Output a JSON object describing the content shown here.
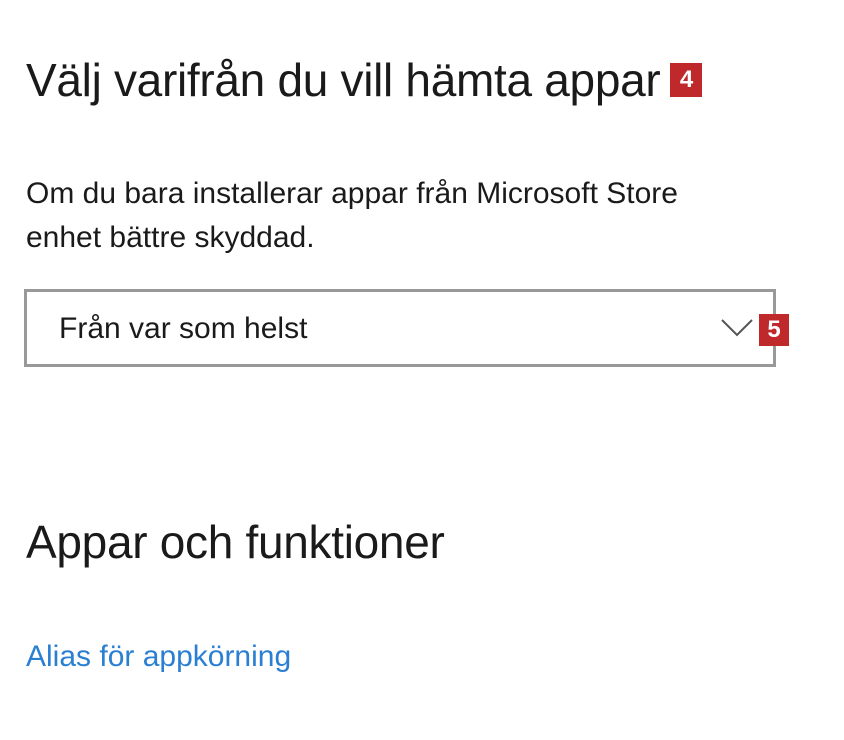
{
  "install_source": {
    "title": "Välj varifrån du vill hämta appar",
    "title_badge": "4",
    "description_line1": "Om du bara installerar appar från Microsoft Store",
    "description_line2": "enhet bättre skyddad.",
    "dropdown": {
      "selected": "Från var som helst",
      "chevron_icon": "chevron-down-icon",
      "badge": "5"
    }
  },
  "apps_features": {
    "title": "Appar och funktioner",
    "link_label": "Alias för appkörning"
  },
  "colors": {
    "badge": "#c0292b",
    "link": "#2a7fd2",
    "dropdown_border": "#999999"
  }
}
